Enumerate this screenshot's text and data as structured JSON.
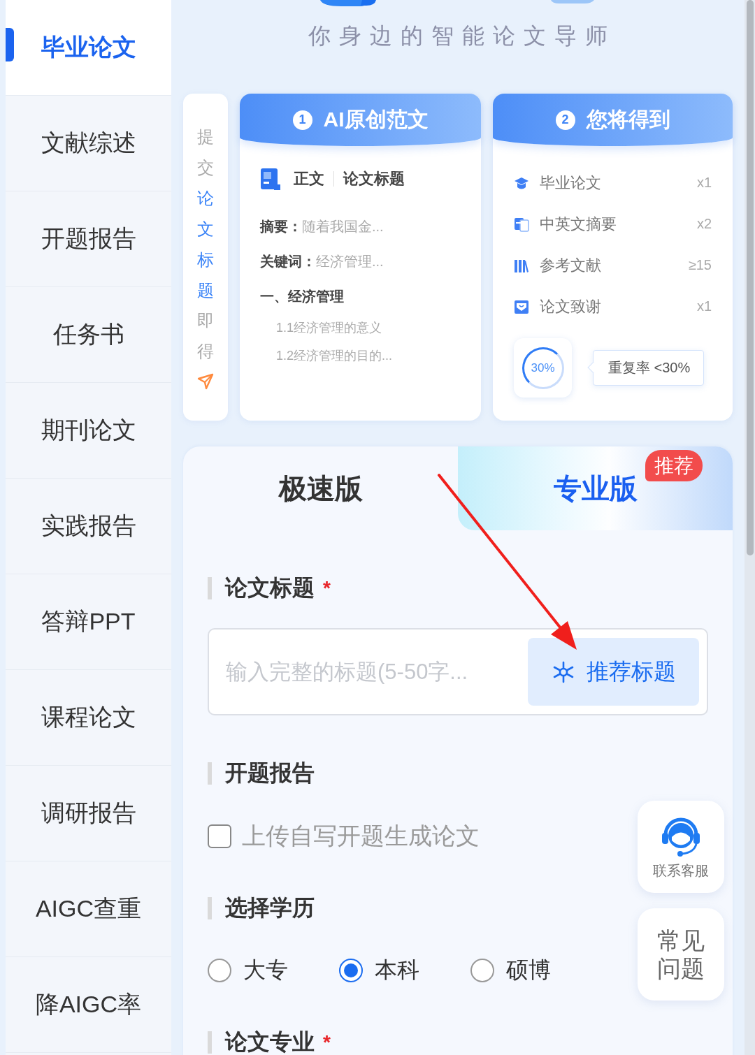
{
  "sidebar": {
    "items": [
      {
        "label": "毕业论文",
        "selected": true
      },
      {
        "label": "文献综述",
        "selected": false
      },
      {
        "label": "开题报告",
        "selected": false
      },
      {
        "label": "任务书",
        "selected": false
      },
      {
        "label": "期刊论文",
        "selected": false
      },
      {
        "label": "实践报告",
        "selected": false
      },
      {
        "label": "答辩PPT",
        "selected": false
      },
      {
        "label": "课程论文",
        "selected": false
      },
      {
        "label": "调研报告",
        "selected": false
      },
      {
        "label": "AIGC查重",
        "selected": false
      },
      {
        "label": "降AIGC率",
        "selected": false
      }
    ]
  },
  "header": {
    "tagline": "你身边的智能论文导师"
  },
  "steps": {
    "caption": "提交**论文标题**即得",
    "cards": [
      {
        "kind": "sample",
        "number": "1",
        "title": "AI原创范文",
        "doc_tag": "正文",
        "doc_title": "论文标题",
        "fields": [
          {
            "label": "摘要：",
            "text": "随着我国金..."
          },
          {
            "label": "关键词：",
            "text": "经济管理..."
          }
        ],
        "outline": [
          {
            "text": "一、经济管理",
            "children": [
              {
                "text": "1.1经济管理的意义"
              },
              {
                "text": "1.2经济管理的目的..."
              }
            ]
          }
        ]
      },
      {
        "kind": "deliverables",
        "number": "2",
        "title": "您将得到",
        "items": [
          {
            "label": "毕业论文",
            "count": "x1"
          },
          {
            "label": "中英文摘要",
            "count": "x2"
          },
          {
            "label": "参考文献",
            "count": "≥15"
          },
          {
            "label": "论文致谢",
            "count": "x1"
          }
        ],
        "ring_label": "30%",
        "note": "重复率 <30%"
      }
    ]
  },
  "tabs": [
    {
      "label": "极速版",
      "selected": false
    },
    {
      "label": "专业版",
      "selected": true,
      "badge": "推荐"
    }
  ],
  "form": {
    "fields": [
      {
        "kind": "text",
        "label": "论文标题",
        "required_mark": "*",
        "placeholder": "输入完整的标题(5-50字...",
        "action": "推荐标题"
      },
      {
        "kind": "checkbox",
        "label": "开题报告",
        "option": "上传自写开题生成论文",
        "checked": false
      },
      {
        "kind": "radio",
        "label": "选择学历",
        "options": [
          {
            "label": "大专",
            "selected": false
          },
          {
            "label": "本科",
            "selected": true
          },
          {
            "label": "硕博",
            "selected": false
          }
        ]
      },
      {
        "kind": "heading",
        "label": "论文专业",
        "required_mark": "*"
      }
    ]
  },
  "float_buttons": [
    {
      "kind": "support",
      "label": "联系客服"
    },
    {
      "kind": "faq",
      "label": "常见问题"
    }
  ]
}
